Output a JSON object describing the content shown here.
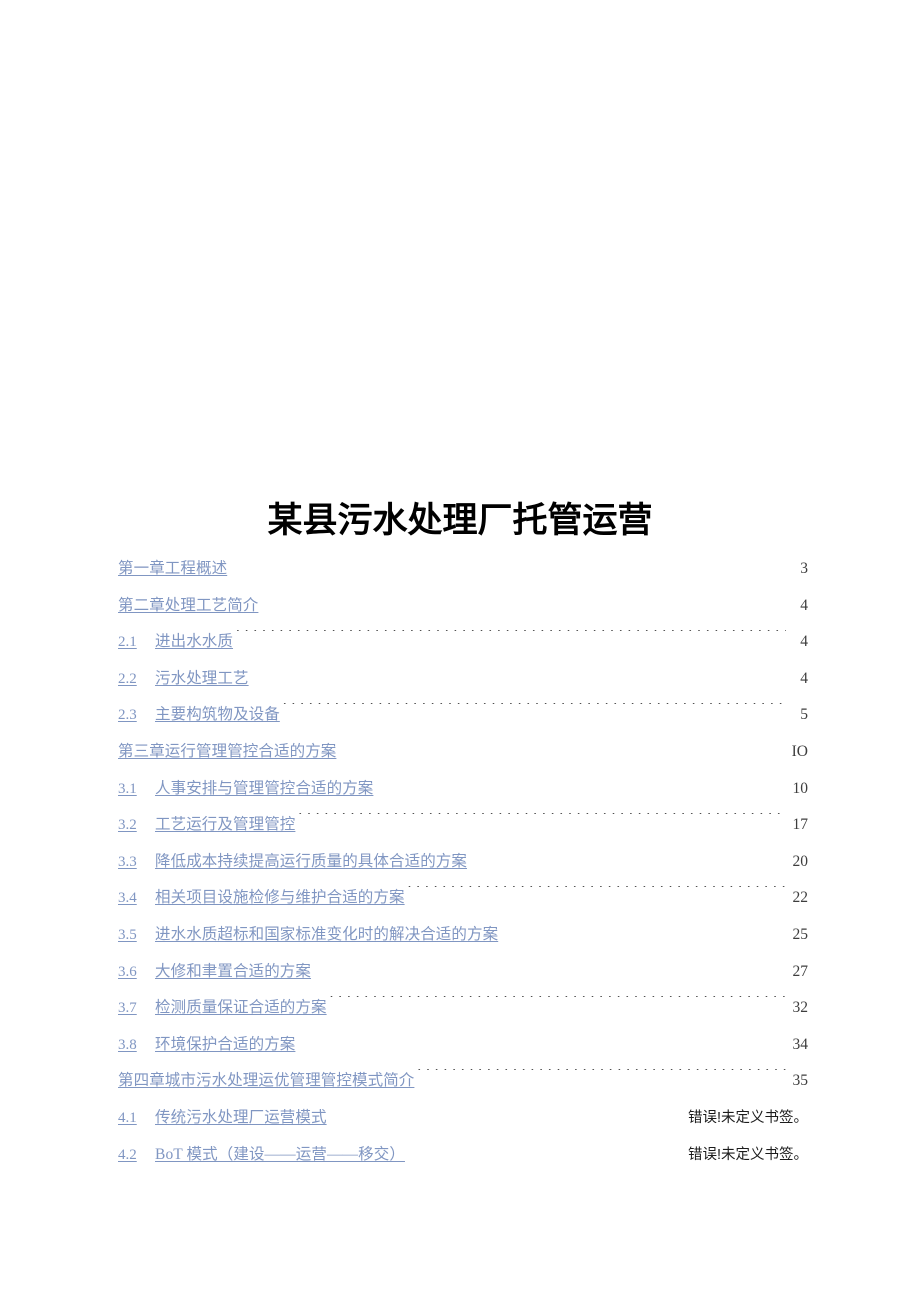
{
  "document": {
    "title": "某县污水处理厂托管运营",
    "link_color": "#8096c2",
    "page_number_color": "#3d3d3d",
    "error_text_color": "#1c1c1c",
    "background": "#ffffff"
  },
  "toc": {
    "entries": [
      {
        "level": 1,
        "number": "",
        "label": "第一章工程概述",
        "page": "3",
        "is_error": false
      },
      {
        "level": 1,
        "number": "",
        "label": "第二章处理工艺简介",
        "page": "4",
        "is_error": false
      },
      {
        "level": 2,
        "number": "2.1",
        "label": "进出水水质",
        "page": "4",
        "is_error": false
      },
      {
        "level": 2,
        "number": "2.2",
        "label": "污水处理工艺",
        "page": "4",
        "is_error": false
      },
      {
        "level": 2,
        "number": "2.3",
        "label": "主要构筑物及设备",
        "page": "5",
        "is_error": false
      },
      {
        "level": 1,
        "number": "",
        "label": "第三章运行管理管控合适的方案",
        "page": "IO",
        "is_error": false
      },
      {
        "level": 2,
        "number": "3.1",
        "label": "人事安排与管理管控合适的方案",
        "page": "10",
        "is_error": false
      },
      {
        "level": 2,
        "number": "3.2",
        "label": "工艺运行及管理管控",
        "page": "17",
        "is_error": false
      },
      {
        "level": 2,
        "number": "3.3",
        "label": "降低成本持续提高运行质量的具体合适的方案",
        "page": "20",
        "is_error": false
      },
      {
        "level": 2,
        "number": "3.4",
        "label": "相关项目设施检修与维护合适的方案",
        "page": "22",
        "is_error": false
      },
      {
        "level": 2,
        "number": "3.5",
        "label": "进水水质超标和国家标准变化时的解决合适的方案",
        "page": "25",
        "is_error": false
      },
      {
        "level": 2,
        "number": "3.6",
        "label": "大修和聿置合适的方案",
        "page": "27",
        "is_error": false
      },
      {
        "level": 2,
        "number": "3.7",
        "label": "检测质量保证合适的方案",
        "page": "32",
        "is_error": false
      },
      {
        "level": 2,
        "number": "3.8",
        "label": "环境保护合适的方案",
        "page": "34",
        "is_error": false
      },
      {
        "level": 1,
        "number": "",
        "label": "第四章城市污水处理运优管理管控模式简介",
        "page": "35",
        "is_error": false
      },
      {
        "level": 2,
        "number": "4.1",
        "label": "传统污水处理厂运营模式",
        "page": "错误!未定义书签。",
        "is_error": true
      },
      {
        "level": 2,
        "number": "4.2",
        "label": "BoT 模式（建设——运营——移交）",
        "page": "错误!未定义书签。",
        "is_error": true
      }
    ]
  }
}
